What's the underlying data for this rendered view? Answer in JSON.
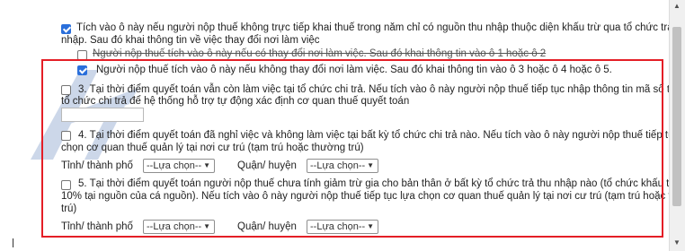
{
  "top_option": {
    "line1": "Tích vào ô này nếu người nộp thuế không trực tiếp khai thuế trong năm chỉ có nguồn thu nhập thuộc diện khấu trừ qua tổ chức trả thu",
    "line2": "nhập. Sau đó khai thông tin về việc thay đổi nơi làm việc",
    "checked": true
  },
  "sub_option_a": {
    "text": "Người nộp thuế tích vào ô này nếu có thay đổi nơi làm việc. Sau đó khai thông tin vào ô 1 hoặc ô 2",
    "checked": false
  },
  "sub_option_b": {
    "text": "Người nộp thuế tích vào ô này nếu không thay đổi nơi làm việc. Sau đó khai thông tin vào ô 3 hoặc ô 4 hoặc ô 5.",
    "checked": true
  },
  "option3": {
    "line1": "3. Tại thời điểm quyết toán vẫn còn làm việc tại tổ chức chi trả. Nếu tích vào ô này người nộp thuế tiếp tục nhập thông tin mã số thuế của",
    "line2": "tổ chức chi trả để hệ thống hỗ trợ tự động xác định cơ quan thuế quyết toán",
    "checked": false,
    "tax_id_value": ""
  },
  "option4": {
    "line1": "4. Tại thời điểm quyết toán đã nghỉ việc và không làm việc tại bất kỳ tổ chức chi trả nào. Nếu tích vào ô này người nộp thuế tiếp tục lựa",
    "line2": "chọn cơ quan thuế quản lý tại nơi cư trú (tạm trú hoặc thường trú)",
    "checked": false,
    "province_label": "Tỉnh/ thành phố",
    "province_value": "--Lựa chọn--",
    "district_label": "Quận/ huyện",
    "district_value": "--Lựa chọn--"
  },
  "option5": {
    "line1": "5. Tại thời điểm quyết toán người nộp thuế chưa tính giảm trừ gia cho bản thân ở bất kỳ tổ chức trả thu nhập nào (tổ chức khấu trừ thuế",
    "line2": "10% tại nguồn của cá nguồn). Nếu tích vào ô này người nộp thuế tiếp tục lựa chọn cơ quan thuế quản lý tại nơi cư trú (tạm trú hoặc thường",
    "line3": "trú)",
    "checked": false,
    "province_label": "Tỉnh/ thành phố",
    "province_value": "--Lựa chọn--",
    "district_label": "Quận/ huyện",
    "district_value": "--Lựa chọn--"
  },
  "colors": {
    "highlight_border": "#e41e26",
    "checkbox_checked": "#2a6fdb"
  }
}
